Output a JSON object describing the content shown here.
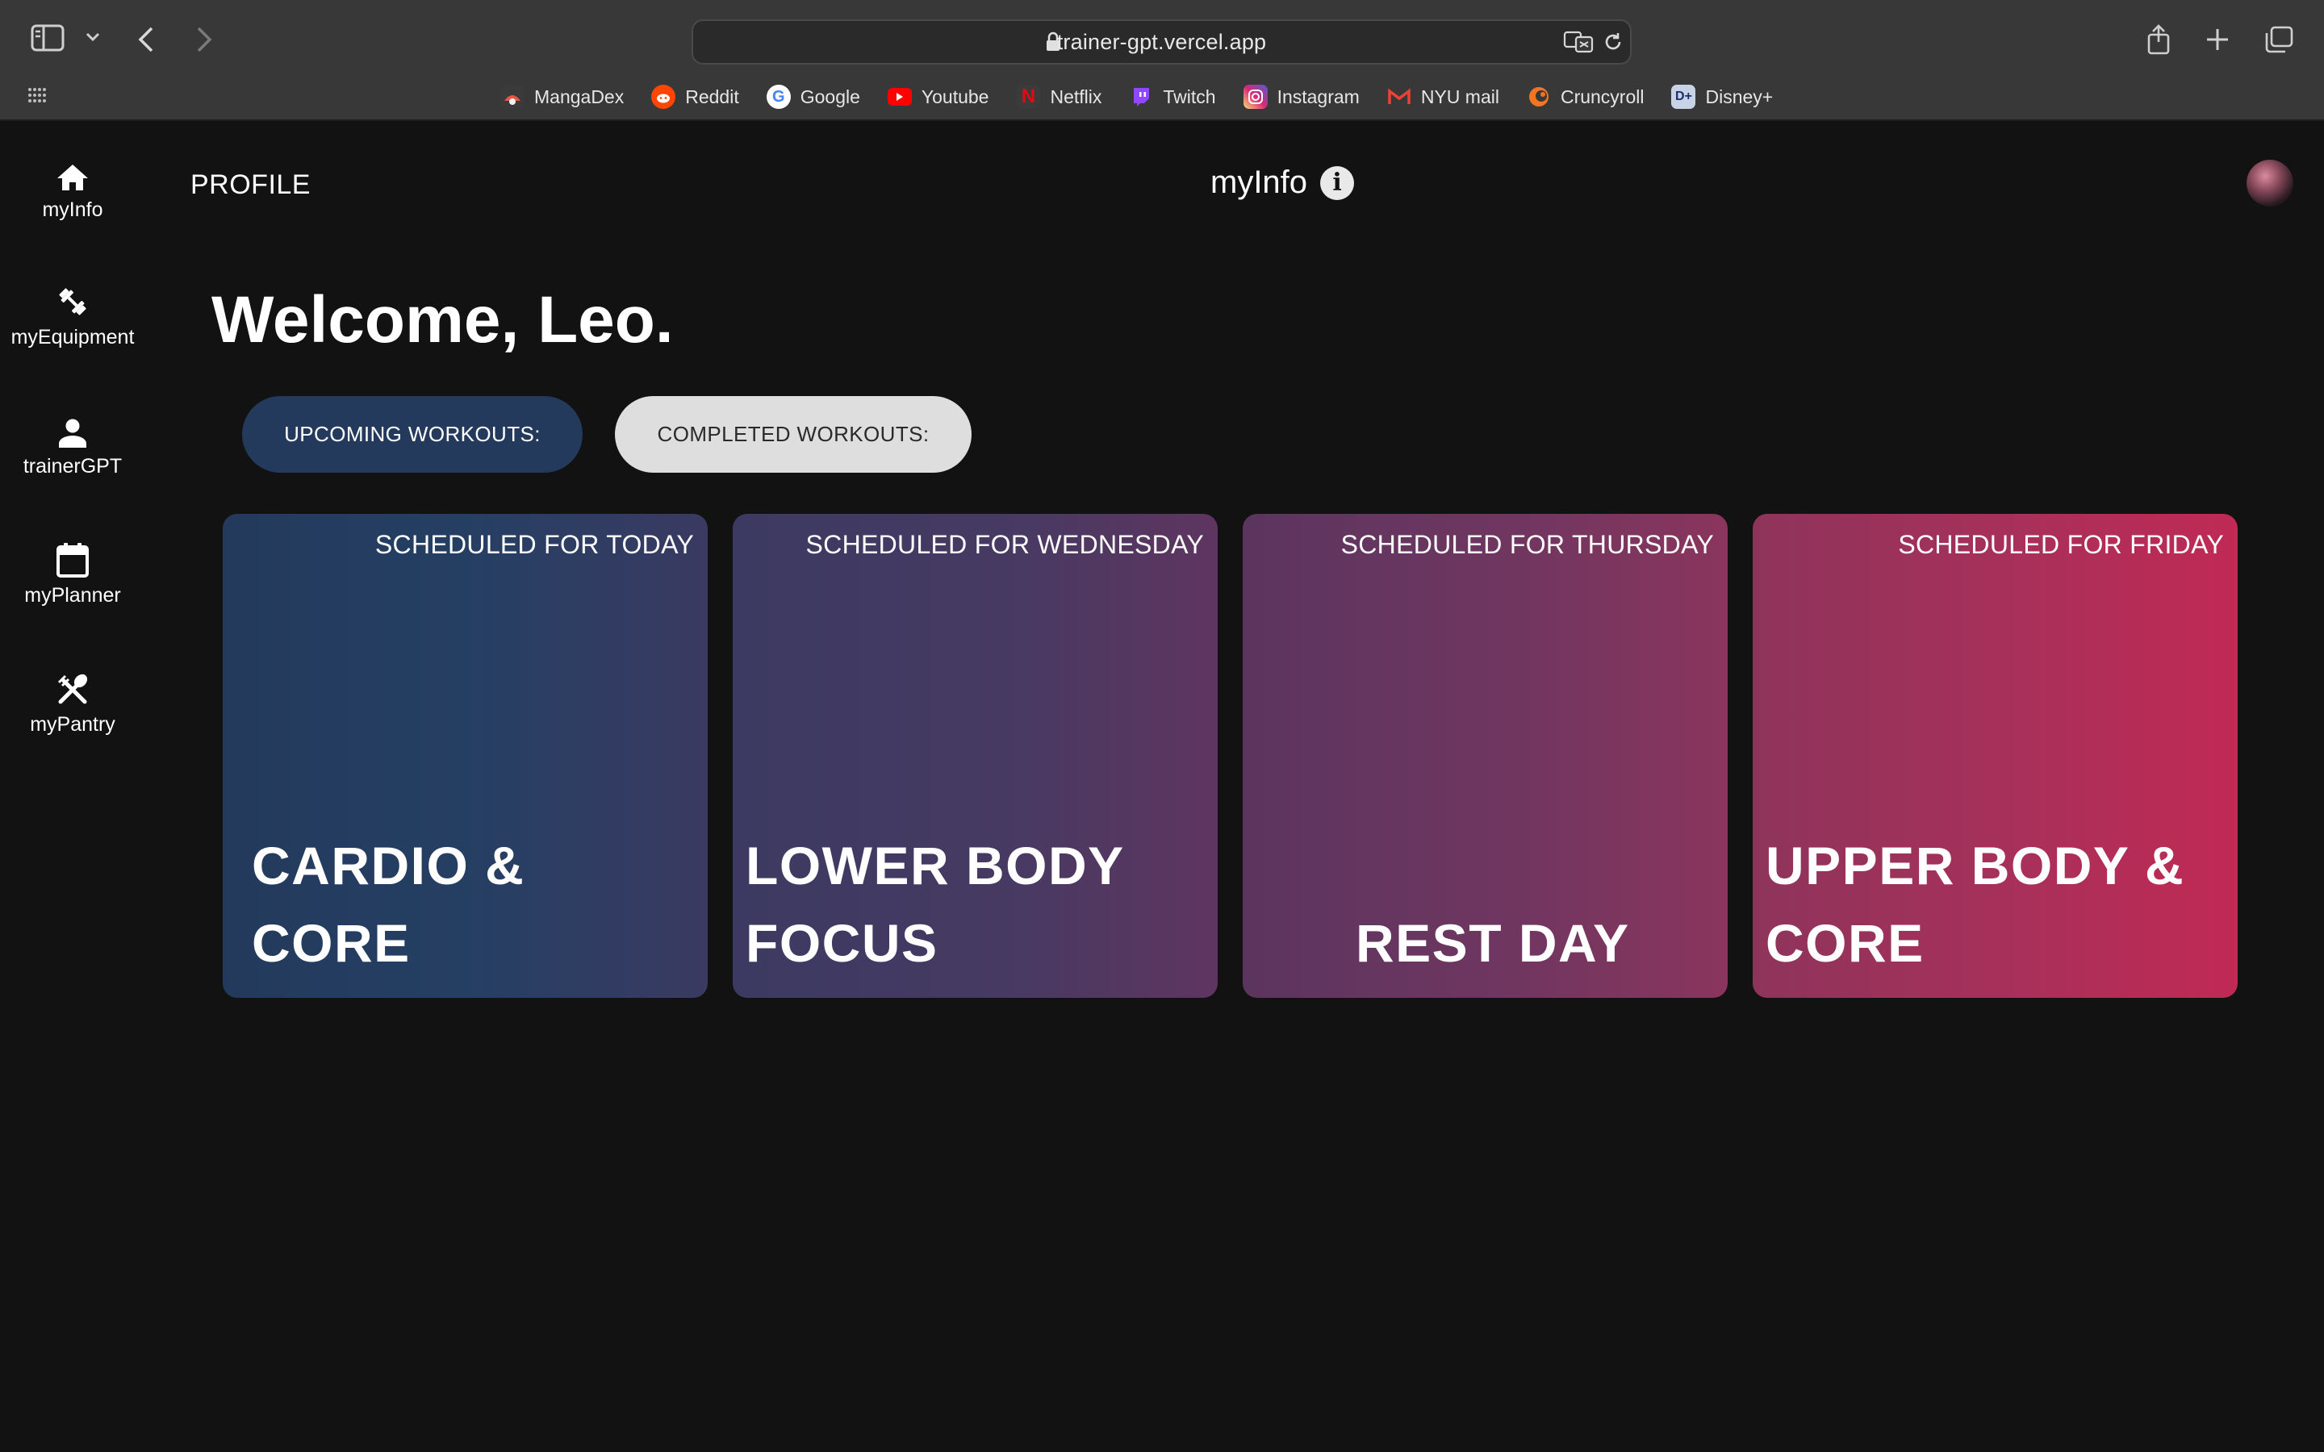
{
  "browser": {
    "url": "trainer-gpt.vercel.app",
    "bookmarks": [
      {
        "label": "MangaDex",
        "icon": "mangadex-icon",
        "color": "#e8573f"
      },
      {
        "label": "Reddit",
        "icon": "reddit-icon",
        "color": "#ff4500"
      },
      {
        "label": "Google",
        "icon": "google-icon",
        "color": "#ffffff"
      },
      {
        "label": "Youtube",
        "icon": "youtube-icon",
        "color": "#ff0000"
      },
      {
        "label": "Netflix",
        "icon": "netflix-icon",
        "color": "#e50914"
      },
      {
        "label": "Twitch",
        "icon": "twitch-icon",
        "color": "#9146ff"
      },
      {
        "label": "Instagram",
        "icon": "instagram-icon",
        "color": "#d62976"
      },
      {
        "label": "NYU mail",
        "icon": "gmail-icon",
        "color": "#ea4335"
      },
      {
        "label": "Cruncyroll",
        "icon": "crunchyroll-icon",
        "color": "#f47521"
      },
      {
        "label": "Disney+",
        "icon": "disney-plus-icon",
        "color": "#c9d3e6"
      }
    ]
  },
  "sidebar": {
    "items": [
      {
        "label": "myInfo",
        "icon": "home-icon"
      },
      {
        "label": "myEquipment",
        "icon": "fitness-icon"
      },
      {
        "label": "trainerGPT",
        "icon": "person-icon"
      },
      {
        "label": "myPlanner",
        "icon": "calendar-icon"
      },
      {
        "label": "myPantry",
        "icon": "utensils-icon"
      }
    ]
  },
  "header": {
    "profile_link": "PROFILE",
    "title": "myInfo",
    "info_glyph": "i"
  },
  "main": {
    "welcome": "Welcome, Leo.",
    "tabs": {
      "upcoming": "UPCOMING WORKOUTS:",
      "completed": "COMPLETED WORKOUTS:"
    },
    "cards": [
      {
        "schedule": "SCHEDULED FOR TODAY",
        "title": "CARDIO & CORE"
      },
      {
        "schedule": "SCHEDULED FOR WEDNESDAY",
        "title": "LOWER BODY FOCUS"
      },
      {
        "schedule": "SCHEDULED FOR THURSDAY",
        "title": "REST DAY"
      },
      {
        "schedule": "SCHEDULED FOR FRIDAY",
        "title": "UPPER BODY & CORE"
      }
    ]
  },
  "colors": {
    "background": "#121212",
    "upcoming_tab": "#233a5c",
    "completed_tab": "#dedede"
  }
}
